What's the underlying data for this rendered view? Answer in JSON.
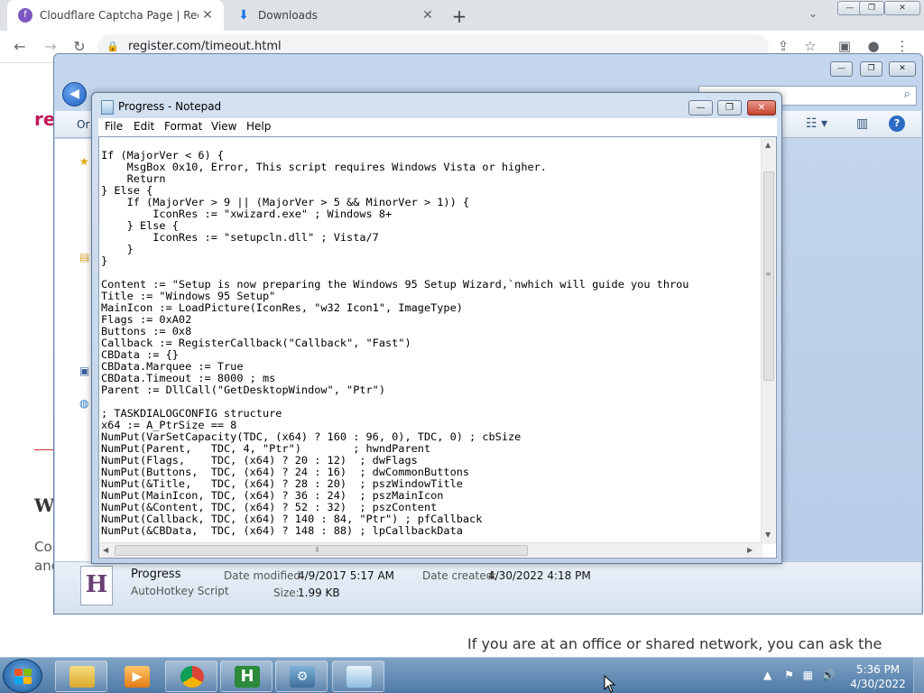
{
  "browser": {
    "tabs": [
      {
        "title": "Cloudflare Captcha Page | Regist",
        "favicon": "f"
      },
      {
        "title": "Downloads"
      }
    ],
    "new_tab": "+",
    "url": "register.com/timeout.html"
  },
  "page": {
    "logo": "re",
    "heading": "W",
    "para_lines": [
      "Co",
      "and"
    ],
    "office_text": "If you are at an office or shared network, you can ask the"
  },
  "explorer": {
    "organize": "Or",
    "details": {
      "file_letter": "H",
      "name": "Progress",
      "type": "AutoHotkey Script",
      "modified_label": "Date modified:",
      "modified_value": "4/9/2017 5:17 AM",
      "created_label": "Date created:",
      "created_value": "4/30/2022 4:18 PM",
      "size_label": "Size:",
      "size_value": "1.99 KB"
    }
  },
  "notepad": {
    "title": "Progress - Notepad",
    "menu": [
      "File",
      "Edit",
      "Format",
      "View",
      "Help"
    ],
    "content": "If (MajorVer < 6) {\n    MsgBox 0x10, Error, This script requires Windows Vista or higher.\n    Return\n} Else {\n    If (MajorVer > 9 || (MajorVer > 5 && MinorVer > 1)) {\n        IconRes := \"xwizard.exe\" ; Windows 8+\n    } Else {\n        IconRes := \"setupcln.dll\" ; Vista/7\n    }\n}\n\nContent := \"Setup is now preparing the Windows 95 Setup Wizard,`nwhich will guide you throu\nTitle := \"Windows 95 Setup\"\nMainIcon := LoadPicture(IconRes, \"w32 Icon1\", ImageType)\nFlags := 0xA02\nButtons := 0x8\nCallback := RegisterCallback(\"Callback\", \"Fast\")\nCBData := {}\nCBData.Marquee := True\nCBData.Timeout := 8000 ; ms\nParent := DllCall(\"GetDesktopWindow\", \"Ptr\")\n\n; TASKDIALOGCONFIG structure\nx64 := A_PtrSize == 8\nNumPut(VarSetCapacity(TDC, (x64) ? 160 : 96, 0), TDC, 0) ; cbSize\nNumPut(Parent,   TDC, 4, \"Ptr\")        ; hwndParent\nNumPut(Flags,    TDC, (x64) ? 20 : 12)  ; dwFlags\nNumPut(Buttons,  TDC, (x64) ? 24 : 16)  ; dwCommonButtons\nNumPut(&Title,   TDC, (x64) ? 28 : 20)  ; pszWindowTitle\nNumPut(MainIcon, TDC, (x64) ? 36 : 24)  ; pszMainIcon\nNumPut(&Content, TDC, (x64) ? 52 : 32)  ; pszContent\nNumPut(Callback, TDC, (x64) ? 140 : 84, \"Ptr\") ; pfCallback\nNumPut(&CBData,  TDC, (x64) ? 148 : 88) ; lpCallbackData"
  },
  "taskbar": {
    "time": "5:36 PM",
    "date": "4/30/2022",
    "apps": [
      "explorer-icon",
      "media-player-icon",
      "chrome-icon",
      "autohotkey-icon",
      "setup-icon",
      "notepad-icon"
    ]
  }
}
